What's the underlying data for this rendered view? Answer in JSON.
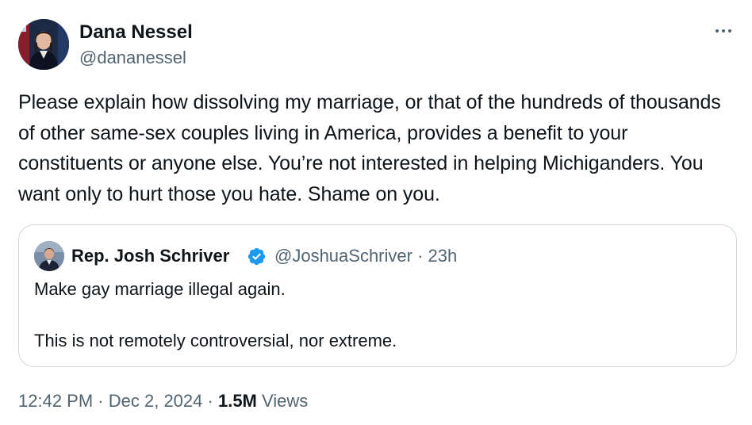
{
  "author": {
    "name": "Dana Nessel",
    "handle": "@dananessel"
  },
  "tweet": {
    "text": "Please explain how dissolving my marriage, or that of the hundreds of thousands of other same-sex couples living in America, provides a benefit to your constituents or anyone else. You’re not interested in helping Michiganders. You want only to hurt those you hate. Shame on you."
  },
  "quoted_tweet": {
    "name": "Rep. Josh Schriver",
    "handle": "@JoshuaSchriver",
    "separator": "·",
    "time": "23h",
    "line1": "Make gay marriage illegal again.",
    "line2": "This is not remotely controversial, nor extreme."
  },
  "meta": {
    "time": "12:42 PM",
    "separator": "·",
    "date": "Dec 2, 2024",
    "views_count": "1.5M",
    "views_label": "Views"
  },
  "icons": {
    "more": "more-horizontal-icon",
    "verified": "verified-badge-icon"
  },
  "colors": {
    "text_primary": "#0f1419",
    "text_secondary": "#536471",
    "verified_blue": "#1d9bf0",
    "card_border": "#cfd9de"
  }
}
